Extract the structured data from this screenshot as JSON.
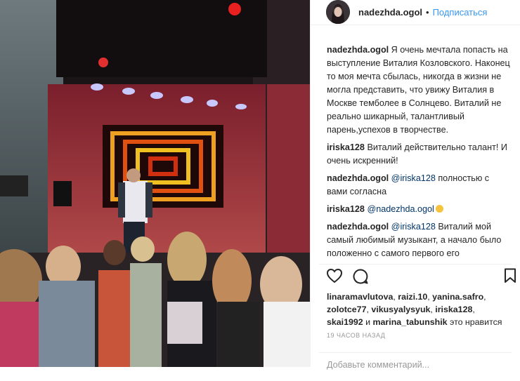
{
  "header": {
    "username": "nadezhda.ogol",
    "dot": "•",
    "follow_label": "Подписаться"
  },
  "caption": {
    "username": "nadezhda.ogol",
    "text": "Я очень мечтала попасть на выступление Виталия Козловского. Наконец то моя мечта сбылась, никогда в жизни не могла представить, что увижу Виталия в Москве темболее в Солнцево. Виталий не реально шикарный, талантливый парень,успехов в творчестве."
  },
  "comments": [
    {
      "username": "iriska128",
      "mention": "",
      "text": "Виталий действительно талант! И очень искренний!"
    },
    {
      "username": "nadezhda.ogol",
      "mention": "@iriska128",
      "text": " полностью с вами согласна"
    },
    {
      "username": "iriska128",
      "mention": "@nadezhda.ogol",
      "text": ""
    },
    {
      "username": "nadezhda.ogol",
      "mention": "@iriska128",
      "text": " Виталий мой самый любимый музыкант, а начало было положенно с самого первого его выступления в Киеве на караоке на майдане, затем проект шанс. Так что за"
    }
  ],
  "icons": {
    "like": "heart-icon",
    "comment": "comment-icon",
    "save": "bookmark-icon"
  },
  "likes": {
    "users": [
      "linaramavlutova",
      "raizi.10",
      "yanina.safro",
      "zolotce77",
      "vikusyalysyuk",
      "iriska128",
      "skai1992"
    ],
    "and": "и",
    "last_user": "marina_tabunshik",
    "suffix": "это нравится"
  },
  "timestamp": "19 ЧАСОВ НАЗАД",
  "add_comment_placeholder": "Добавьте комментарий...",
  "colors": {
    "link": "#3897f0",
    "mention": "#003569",
    "text": "#262626",
    "muted": "#999999"
  }
}
